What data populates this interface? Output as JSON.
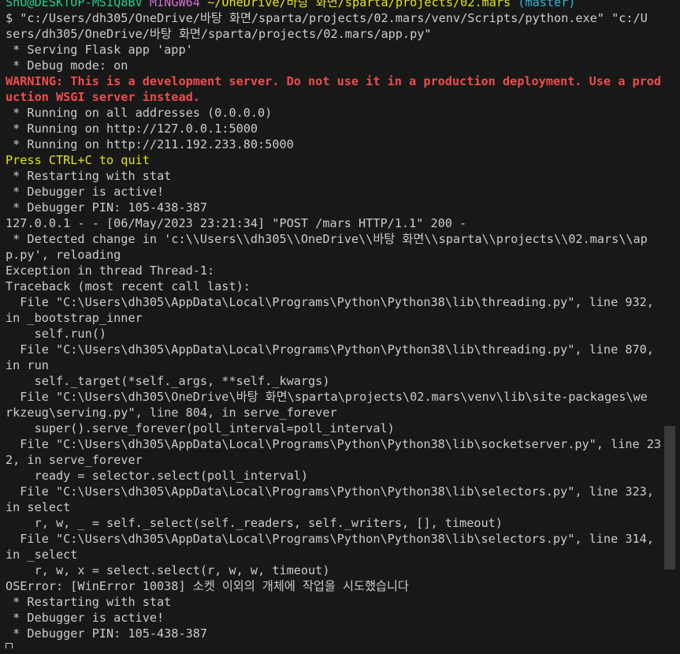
{
  "prompt": {
    "user_host": "ShU@DESKTOP-MSIQ8BV",
    "shell": "MINGW64",
    "path": "~/OneDrive/바탕 화면/sparta/projects/02.mars",
    "branch": "(master)"
  },
  "lines": [
    {
      "cls": "",
      "text": "$ \"c:/Users/dh305/OneDrive/바탕 화면/sparta/projects/02.mars/venv/Scripts/python.exe\" \"c:/U"
    },
    {
      "cls": "",
      "text": "sers/dh305/OneDrive/바탕 화면/sparta/projects/02.mars/app.py\""
    },
    {
      "cls": "",
      "text": " * Serving Flask app 'app'"
    },
    {
      "cls": "",
      "text": " * Debug mode: on"
    },
    {
      "cls": "c-red",
      "text": "WARNING: This is a development server. Do not use it in a production deployment. Use a prod"
    },
    {
      "cls": "c-red",
      "text": "uction WSGI server instead."
    },
    {
      "cls": "",
      "text": " * Running on all addresses (0.0.0.0)"
    },
    {
      "cls": "",
      "text": " * Running on http://127.0.0.1:5000"
    },
    {
      "cls": "",
      "text": " * Running on http://211.192.233.80:5000"
    },
    {
      "cls": "c-yellowtext",
      "text": "Press CTRL+C to quit"
    },
    {
      "cls": "",
      "text": " * Restarting with stat"
    },
    {
      "cls": "",
      "text": " * Debugger is active!"
    },
    {
      "cls": "",
      "text": " * Debugger PIN: 105-438-387"
    },
    {
      "cls": "",
      "text": "127.0.0.1 - - [06/May/2023 23:21:34] \"POST /mars HTTP/1.1\" 200 -"
    },
    {
      "cls": "",
      "text": " * Detected change in 'c:\\\\Users\\\\dh305\\\\OneDrive\\\\바탕 화면\\\\sparta\\\\projects\\\\02.mars\\\\ap"
    },
    {
      "cls": "",
      "text": "p.py', reloading"
    },
    {
      "cls": "",
      "text": "Exception in thread Thread-1:"
    },
    {
      "cls": "",
      "text": "Traceback (most recent call last):"
    },
    {
      "cls": "",
      "text": "  File \"C:\\Users\\dh305\\AppData\\Local\\Programs\\Python\\Python38\\lib\\threading.py\", line 932,"
    },
    {
      "cls": "",
      "text": "in _bootstrap_inner"
    },
    {
      "cls": "",
      "text": "    self.run()"
    },
    {
      "cls": "",
      "text": "  File \"C:\\Users\\dh305\\AppData\\Local\\Programs\\Python\\Python38\\lib\\threading.py\", line 870,"
    },
    {
      "cls": "",
      "text": "in run"
    },
    {
      "cls": "",
      "text": "    self._target(*self._args, **self._kwargs)"
    },
    {
      "cls": "",
      "text": "  File \"C:\\Users\\dh305\\OneDrive\\바탕 화면\\sparta\\projects\\02.mars\\venv\\lib\\site-packages\\we"
    },
    {
      "cls": "",
      "text": "rkzeug\\serving.py\", line 804, in serve_forever"
    },
    {
      "cls": "",
      "text": "    super().serve_forever(poll_interval=poll_interval)"
    },
    {
      "cls": "",
      "text": "  File \"C:\\Users\\dh305\\AppData\\Local\\Programs\\Python\\Python38\\lib\\socketserver.py\", line 23"
    },
    {
      "cls": "",
      "text": "2, in serve_forever"
    },
    {
      "cls": "",
      "text": "    ready = selector.select(poll_interval)"
    },
    {
      "cls": "",
      "text": "  File \"C:\\Users\\dh305\\AppData\\Local\\Programs\\Python\\Python38\\lib\\selectors.py\", line 323,"
    },
    {
      "cls": "",
      "text": "in select"
    },
    {
      "cls": "",
      "text": "    r, w, _ = self._select(self._readers, self._writers, [], timeout)"
    },
    {
      "cls": "",
      "text": "  File \"C:\\Users\\dh305\\AppData\\Local\\Programs\\Python\\Python38\\lib\\selectors.py\", line 314,"
    },
    {
      "cls": "",
      "text": "in _select"
    },
    {
      "cls": "",
      "text": "    r, w, x = select.select(r, w, w, timeout)"
    },
    {
      "cls": "",
      "text": "OSError: [WinError 10038] 소켓 이외의 개체에 작업을 시도했습니다"
    },
    {
      "cls": "",
      "text": " * Restarting with stat"
    },
    {
      "cls": "",
      "text": " * Debugger is active!"
    },
    {
      "cls": "",
      "text": " * Debugger PIN: 105-438-387"
    }
  ],
  "colors": {
    "background": "#181818",
    "text": "#cccccc",
    "green": "#23d18b",
    "magenta": "#d670d6",
    "yellow": "#e5e510",
    "cyan": "#29b8db",
    "red": "#f14c4c"
  }
}
